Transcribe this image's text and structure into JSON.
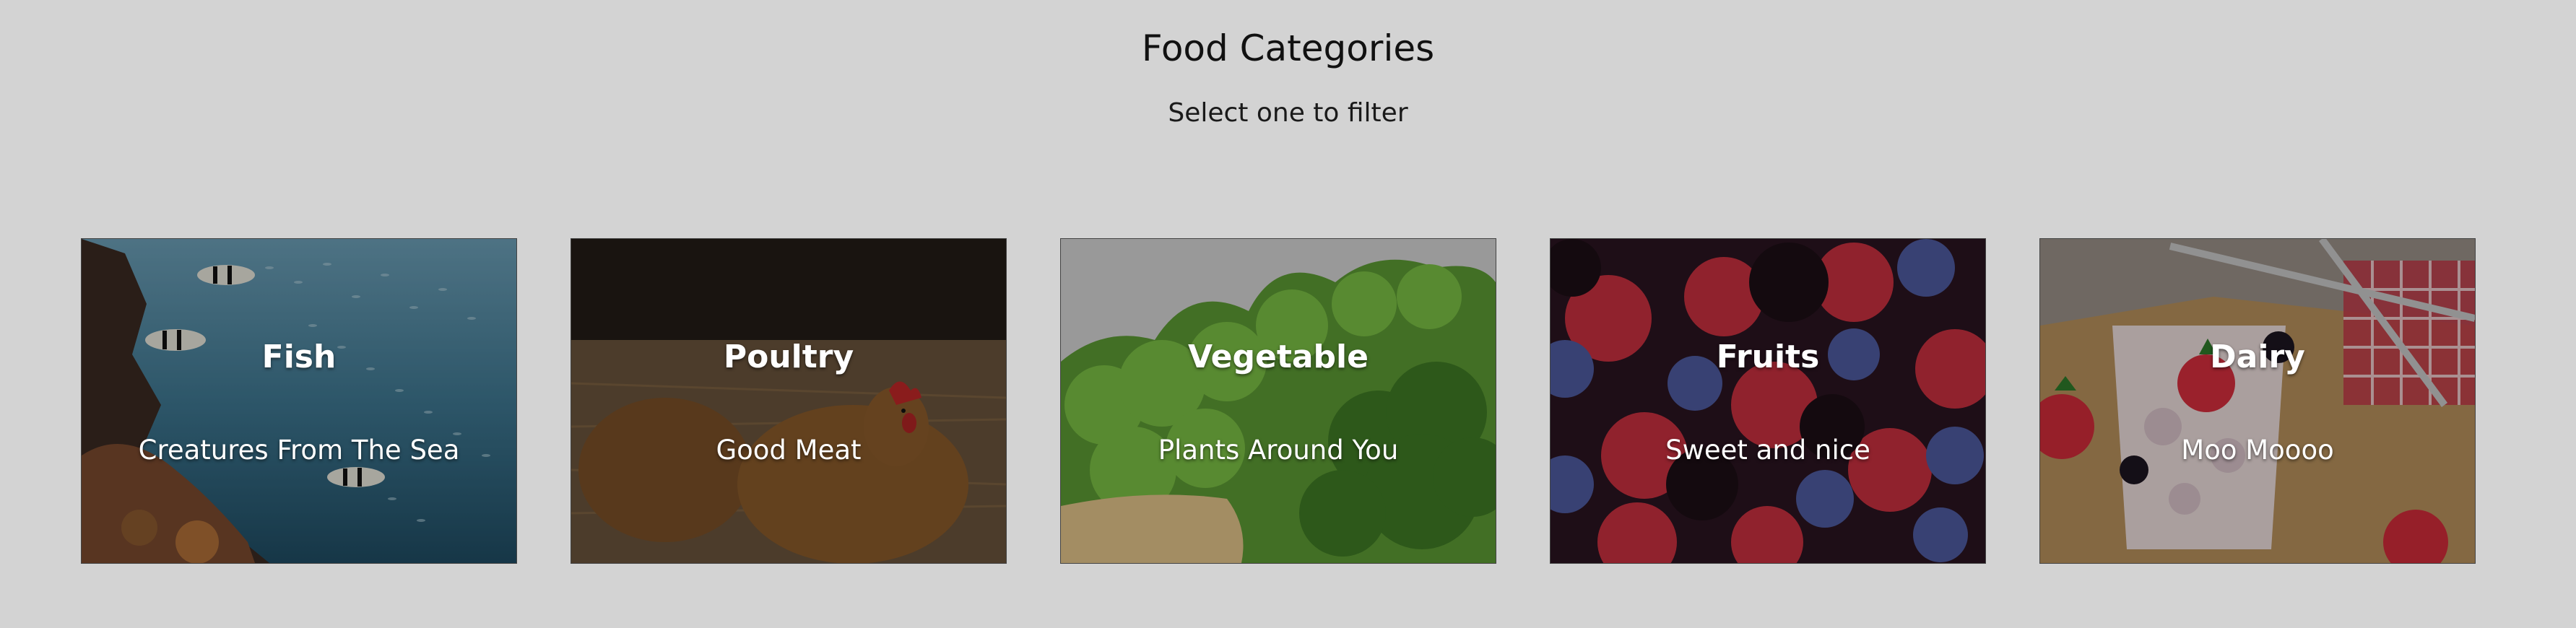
{
  "header": {
    "title": "Food Categories",
    "subtitle": "Select one to filter"
  },
  "categories": [
    {
      "title": "Fish",
      "subtitle": "Creatures From The Sea",
      "image": "underwater-reef-fish-image"
    },
    {
      "title": "Poultry",
      "subtitle": "Good Meat",
      "image": "hen-on-straw-image"
    },
    {
      "title": "Vegetable",
      "subtitle": "Plants Around You",
      "image": "lettuce-broccoli-image"
    },
    {
      "title": "Fruits",
      "subtitle": "Sweet and nice",
      "image": "mixed-berries-image"
    },
    {
      "title": "Dairy",
      "subtitle": "Moo Moooo",
      "image": "yogurt-parfait-image"
    }
  ],
  "colors": {
    "background": "#d3d3d3",
    "card_text": "#ffffff"
  }
}
